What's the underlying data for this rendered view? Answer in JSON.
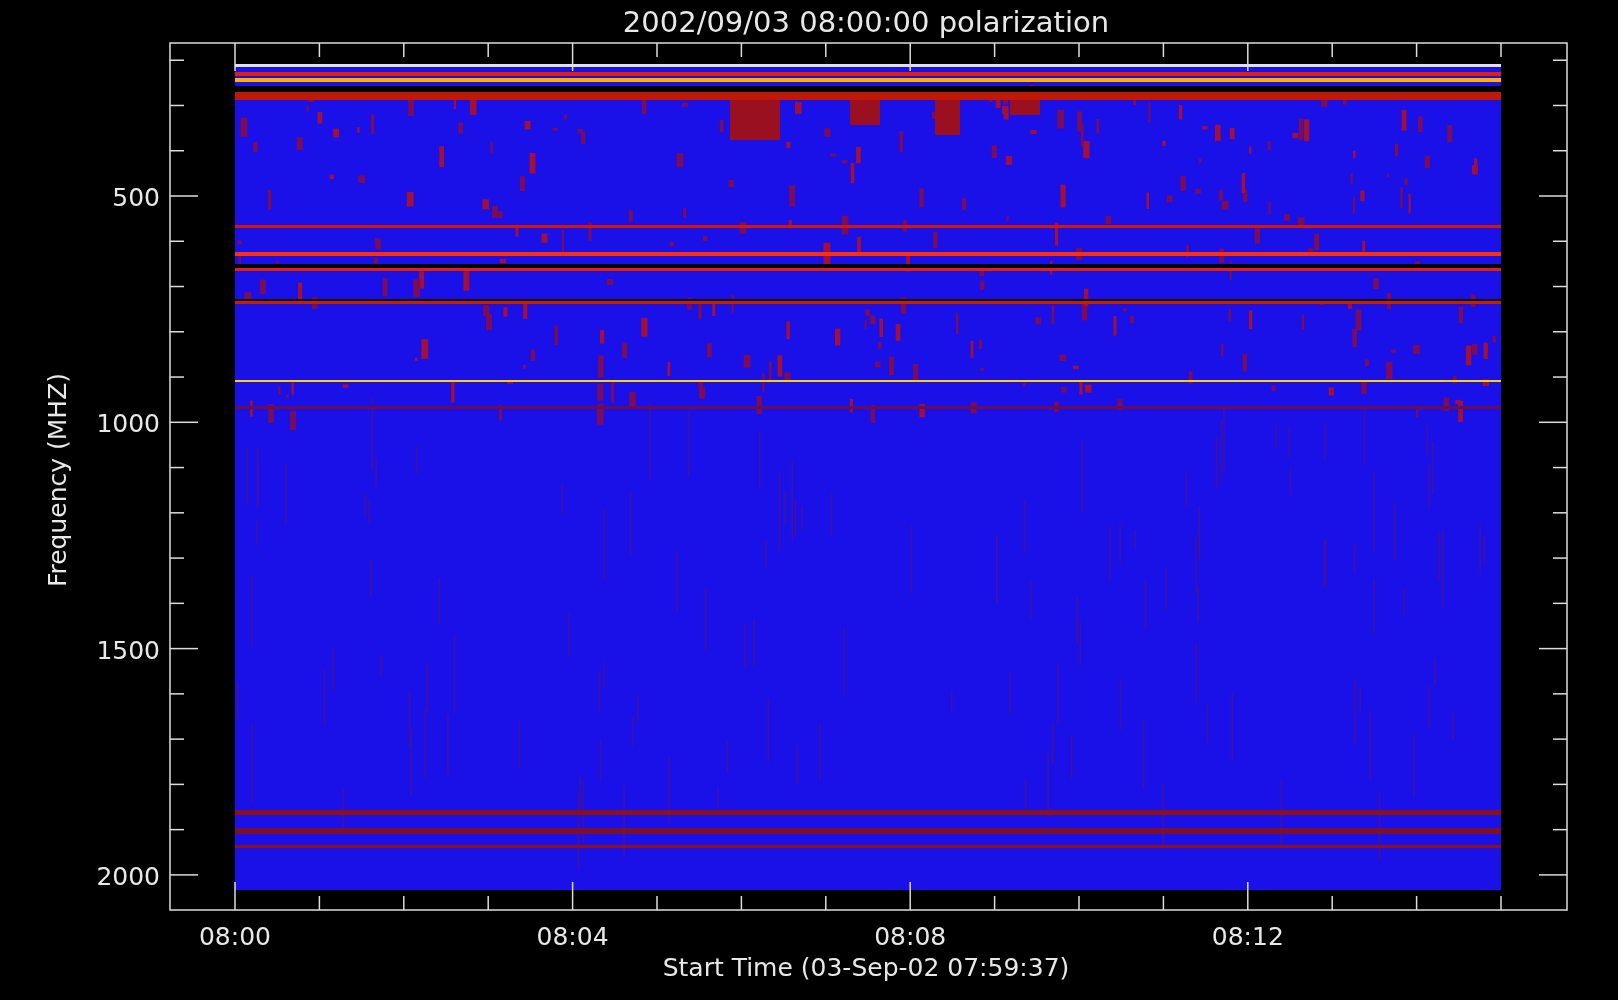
{
  "title": "2002/09/03 08:00:00 polarization",
  "chart": {
    "ylabel": "Frequency (MHZ)",
    "xlabel": "Start Time (03-Sep-02 07:59:37)",
    "yticks": [
      "500",
      "1000",
      "1500",
      "2000"
    ],
    "xticks": [
      "08:00",
      "08:04",
      "08:08",
      "08:12"
    ]
  }
}
